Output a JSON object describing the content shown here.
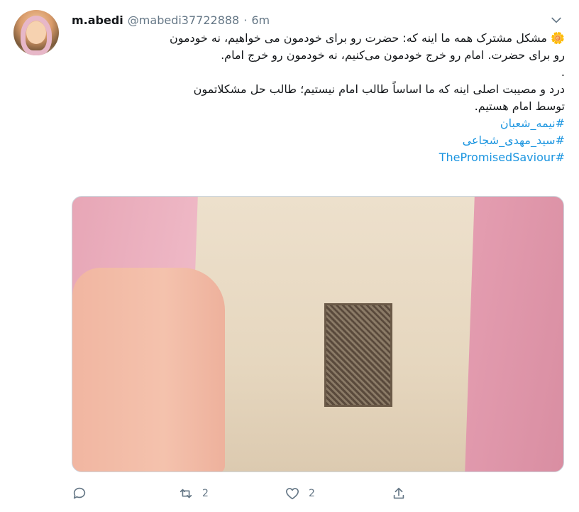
{
  "tweet": {
    "author_name": "m.abedi",
    "handle": "@mabedi37722888",
    "separator": "·",
    "time": "6m",
    "lines": [
      "🌼 مشکل مشترک همه ما اینه که: حضرت رو برای خودمون می خواهیم، نه خودمون",
      "رو برای حضرت. امام رو خرج خودمون می‌کنیم، نه خودمون رو خرج امام.",
      ".",
      "درد و مصیبت اصلی اینه که ما اساساً طالب امام نیستیم؛ طالب حل مشکلاتمون",
      "توسط امام هستیم."
    ],
    "hashtags": [
      "#نیمه_شعبان",
      "#سید_مهدی_شجاعی",
      "#ThePromisedSaviour"
    ]
  },
  "actions": {
    "reply_count": "",
    "retweet_count": "2",
    "like_count": "2"
  },
  "icons": {
    "more": "chevron-down-icon",
    "reply": "reply-icon",
    "retweet": "retweet-icon",
    "like": "heart-icon",
    "share": "share-icon"
  },
  "colors": {
    "link": "#1b95e0",
    "muted": "#657786",
    "text": "#14171a"
  }
}
